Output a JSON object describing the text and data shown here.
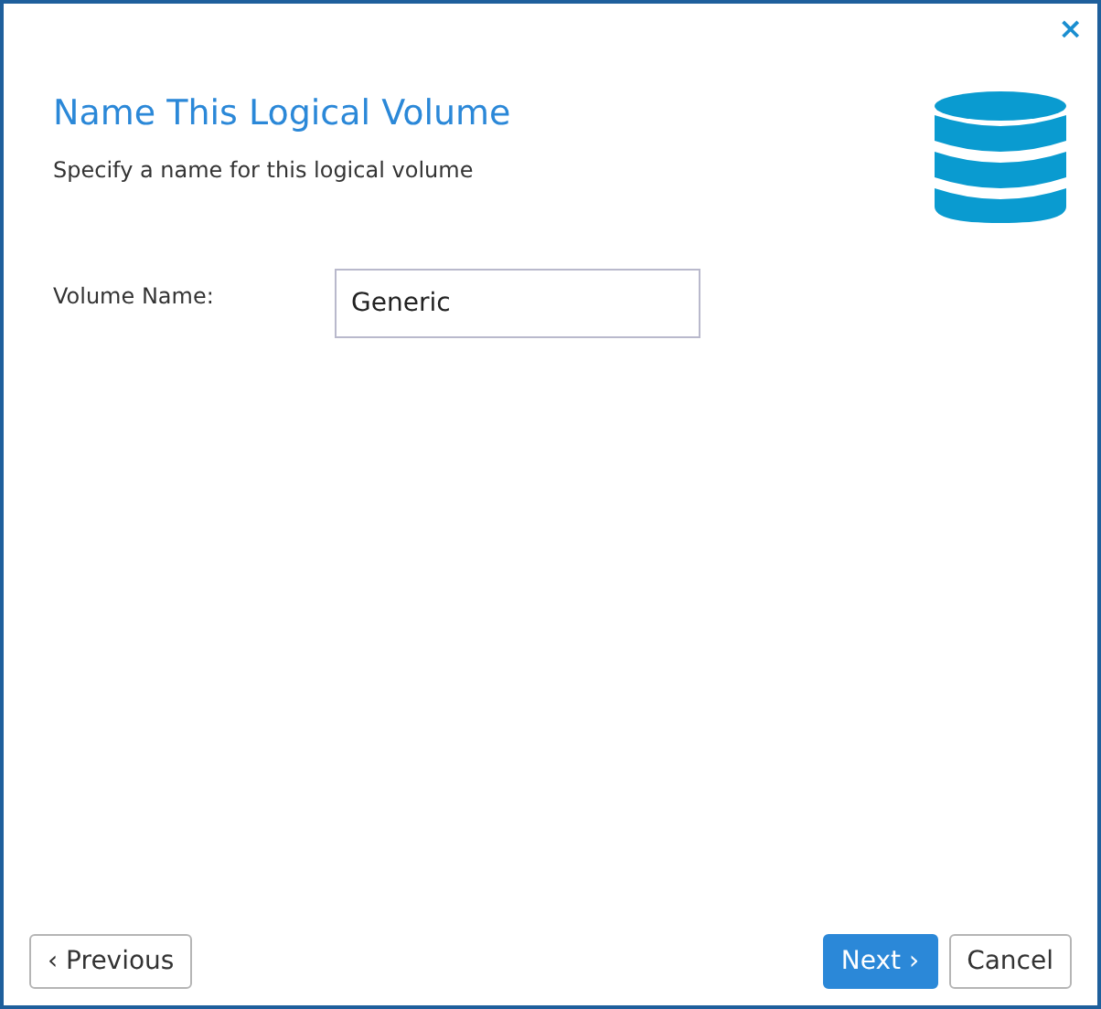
{
  "dialog": {
    "close": "×",
    "title": "Name This Logical Volume",
    "subtitle": "Specify a name for this logical volume"
  },
  "fields": [
    {
      "label": "Volume Name:",
      "value": "Generic"
    }
  ],
  "buttons": [
    {
      "label": "‹ Previous",
      "kind": "default"
    },
    {
      "label": "Next ›",
      "kind": "primary"
    },
    {
      "label": "Cancel",
      "kind": "default"
    }
  ]
}
